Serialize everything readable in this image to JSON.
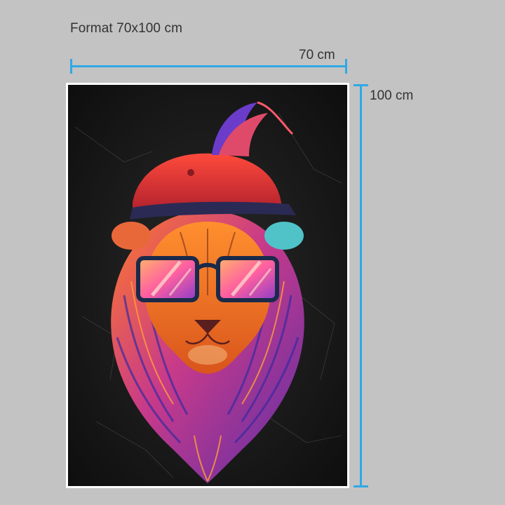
{
  "header": {
    "format_label": "Format 70x100 cm"
  },
  "dimensions": {
    "width_label": "70 cm",
    "height_label": "100 cm"
  },
  "colors": {
    "background": "#c3c3c3",
    "dimension_line": "#2fa9e6",
    "poster_frame": "#ffffff",
    "artwork_background": "#141414"
  },
  "poster": {
    "artwork": "lion-with-cap-and-sunglasses-illustration"
  }
}
